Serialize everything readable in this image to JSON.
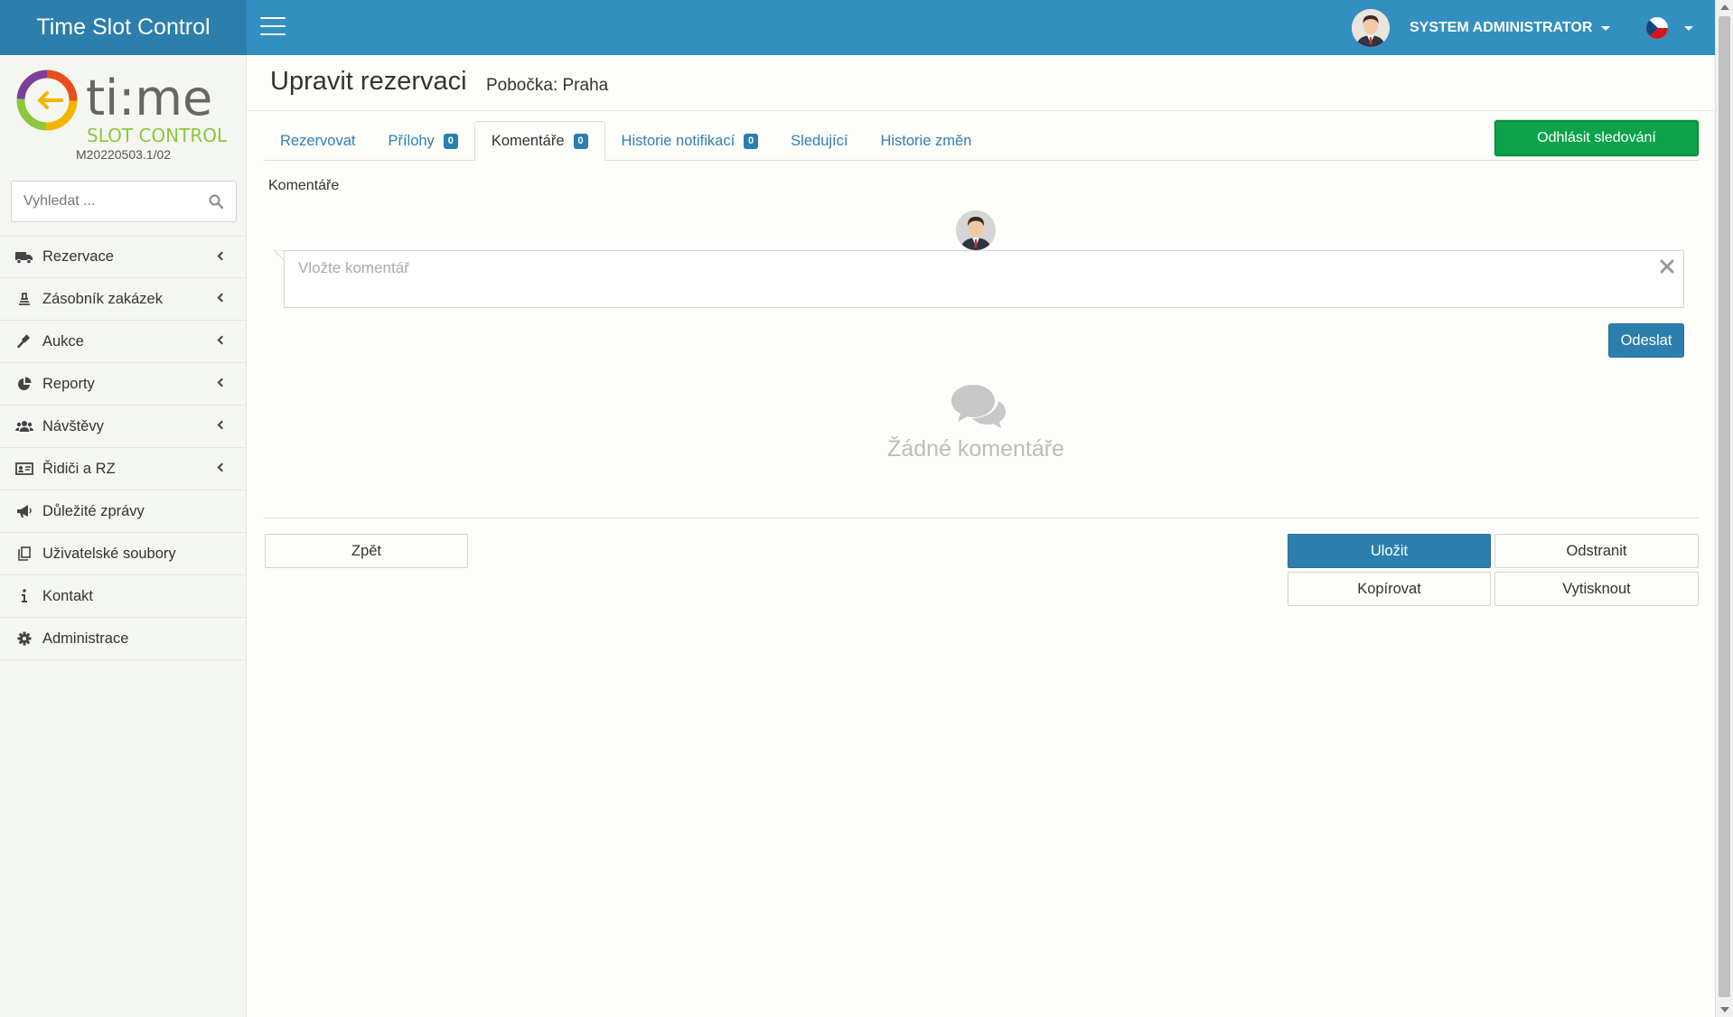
{
  "app": {
    "title": "Time Slot Control"
  },
  "header": {
    "user_name": "SYSTEM ADMINISTRATOR",
    "language_flag": "czech-flag-icon"
  },
  "sidebar": {
    "logo_text_1": "ti:me",
    "logo_text_2": "SLOT CONTROL",
    "version": "M20220503.1/02",
    "search_placeholder": "Vyhledat ...",
    "items": [
      {
        "label": "Rezervace",
        "icon": "truck-icon",
        "has_submenu": true
      },
      {
        "label": "Zásobník zakázek",
        "icon": "stack-icon",
        "has_submenu": true
      },
      {
        "label": "Aukce",
        "icon": "gavel-icon",
        "has_submenu": true
      },
      {
        "label": "Reporty",
        "icon": "pie-chart-icon",
        "has_submenu": true
      },
      {
        "label": "Návštěvy",
        "icon": "users-icon",
        "has_submenu": true
      },
      {
        "label": "Řidiči a RZ",
        "icon": "id-card-icon",
        "has_submenu": true
      },
      {
        "label": "Důležité zprávy",
        "icon": "megaphone-icon",
        "has_submenu": false
      },
      {
        "label": "Uživatelské soubory",
        "icon": "files-icon",
        "has_submenu": false
      },
      {
        "label": "Kontakt",
        "icon": "info-icon",
        "has_submenu": false
      },
      {
        "label": "Administrace",
        "icon": "gear-icon",
        "has_submenu": false
      }
    ]
  },
  "page": {
    "title": "Upravit rezervaci",
    "subtitle": "Pobočka: Praha",
    "unfollow_button": "Odhlásit sledování"
  },
  "tabs": [
    {
      "label": "Rezervovat"
    },
    {
      "label": "Přílohy",
      "badge": "0"
    },
    {
      "label": "Komentáře",
      "badge": "0",
      "active": true
    },
    {
      "label": "Historie notifikací",
      "badge": "0"
    },
    {
      "label": "Sledující"
    },
    {
      "label": "Historie změn"
    }
  ],
  "comments": {
    "section_label": "Komentáře",
    "input_placeholder": "Vložte komentář",
    "input_value": "",
    "send_button": "Odeslat",
    "empty_text": "Žádné komentáře"
  },
  "actions": {
    "back": "Zpět",
    "save": "Uložit",
    "delete": "Odstranit",
    "copy": "Kopírovat",
    "print": "Vytisknout"
  },
  "colors": {
    "header_bg": "#338fc0",
    "brand_bg": "#2c7fad",
    "primary": "#2c7fad",
    "success": "#0ca34a"
  }
}
